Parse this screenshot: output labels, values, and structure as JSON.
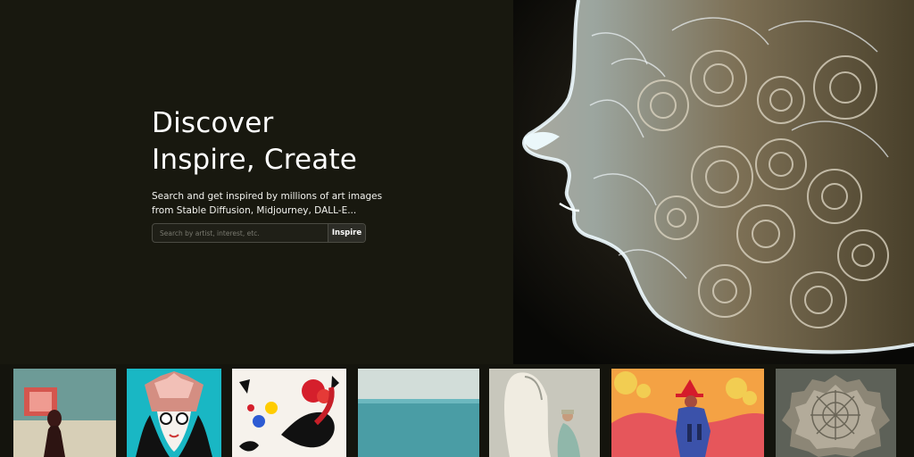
{
  "hero": {
    "title_line_1": "Discover",
    "title_line_2": "Inspire, Create",
    "description_line_1": "Search and get inspired by millions of art images",
    "description_line_2": "from Stable Diffusion, Midjourney, DALL-E..."
  },
  "search": {
    "placeholder": "Search by artist, interest, etc.",
    "value": "",
    "button_label": "Inspire"
  },
  "colors": {
    "page_background": "#18180f",
    "text_primary": "#ffffff",
    "input_border": "#4b4b43",
    "button_background": "#2c2c26"
  },
  "gallery": {
    "items": [
      {
        "name": "gallery-thumb-silhouette-frame"
      },
      {
        "name": "gallery-thumb-masked-portrait"
      },
      {
        "name": "gallery-thumb-abstract-splatter"
      },
      {
        "name": "gallery-thumb-seascape"
      },
      {
        "name": "gallery-thumb-veiled-figure"
      },
      {
        "name": "gallery-thumb-red-hat-figure"
      },
      {
        "name": "gallery-thumb-ornate-headdress"
      }
    ]
  }
}
